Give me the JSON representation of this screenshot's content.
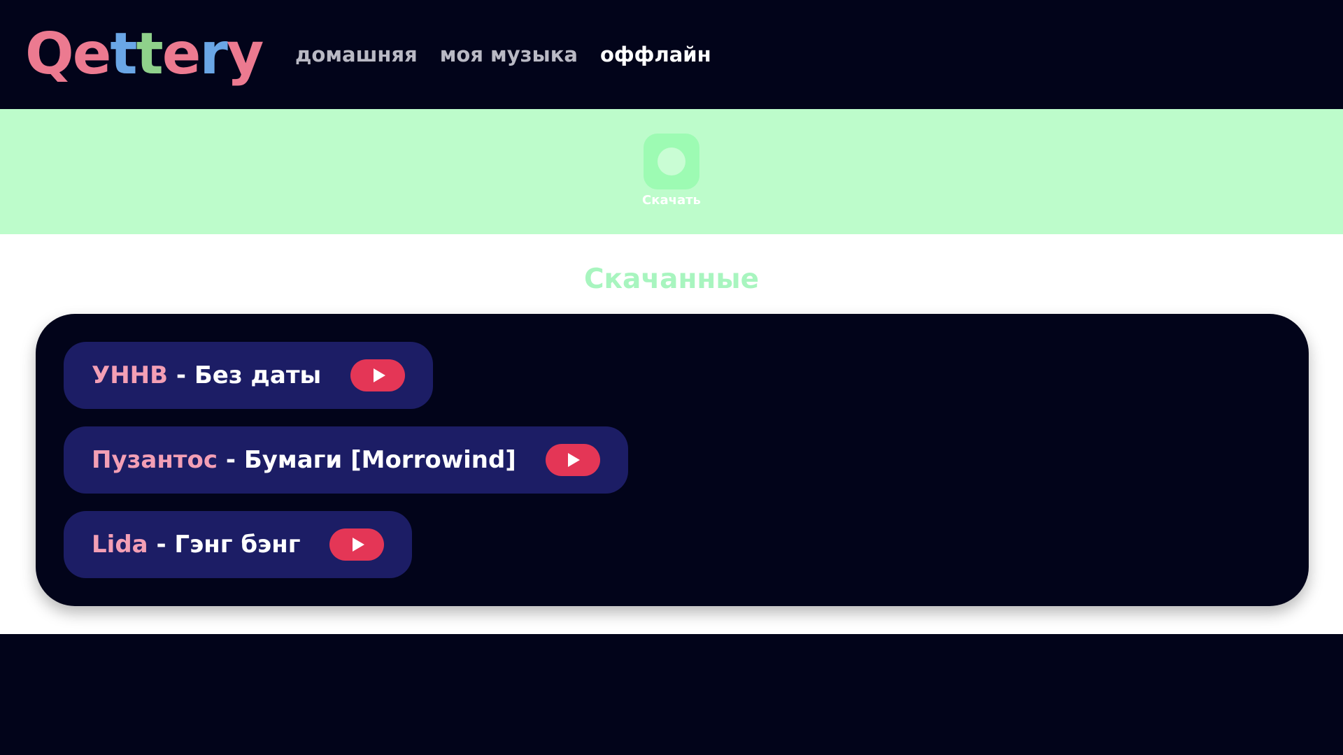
{
  "app": {
    "logo_text": "Qettery"
  },
  "nav": {
    "items": [
      {
        "label": "домашняя",
        "active": false
      },
      {
        "label": "моя музыка",
        "active": false
      },
      {
        "label": "оффлайн",
        "active": true
      }
    ]
  },
  "banner": {
    "download_label": "Скачать",
    "icon": "circle-download-icon"
  },
  "downloads": {
    "title": "Скачанные",
    "tracks": [
      {
        "artist": "УННВ",
        "separator": " - ",
        "title": "Без даты"
      },
      {
        "artist": "Пузантос",
        "separator": " - ",
        "title": "Бумаги [Morrowind]"
      },
      {
        "artist": "Lida",
        "separator": " - ",
        "title": "Гэнг бэнг"
      }
    ]
  },
  "colors": {
    "background": "#02041a",
    "banner": "#bdfccb",
    "accent_pink": "#f39fb5",
    "play_red": "#e43656",
    "track_bg": "#1c1d65",
    "section_title": "#a8f5bf"
  }
}
